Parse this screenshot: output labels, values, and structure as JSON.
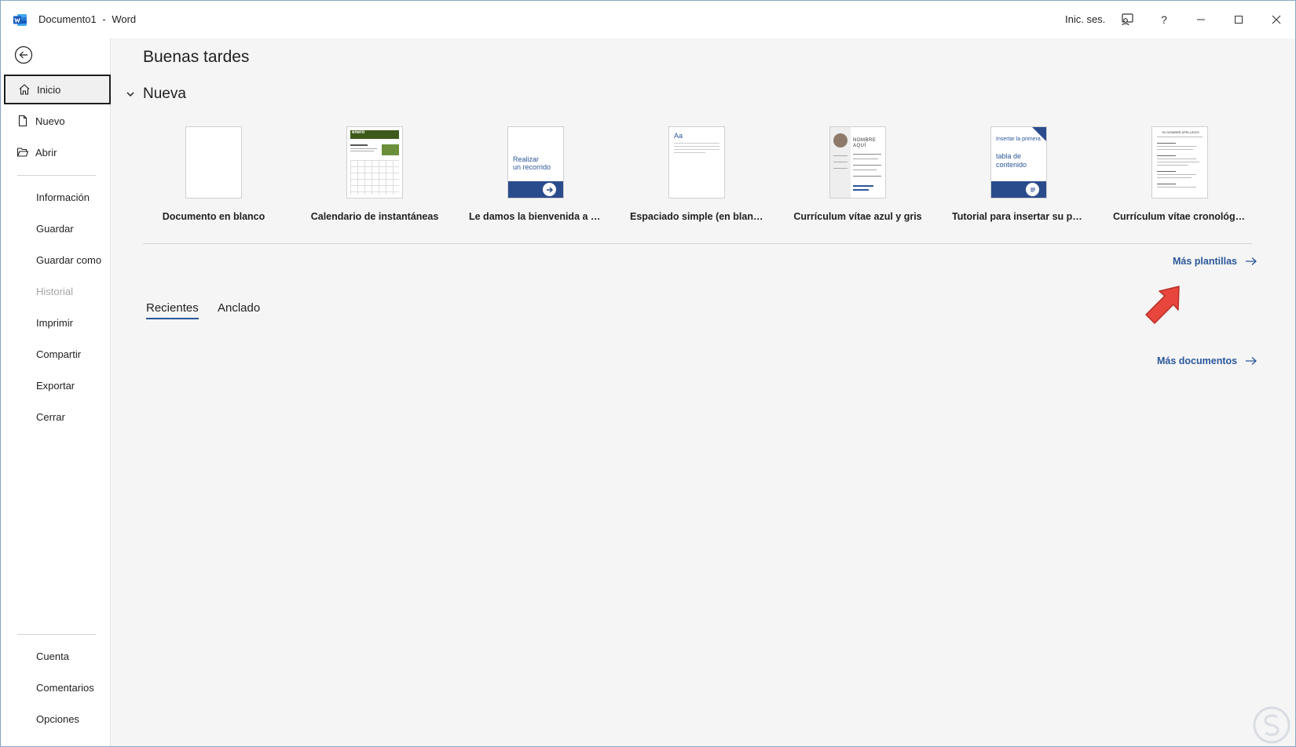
{
  "window": {
    "doc_title": "Documento1",
    "separator": "-",
    "app_name": "Word",
    "sign_in": "Inic. ses."
  },
  "sidebar": {
    "items": [
      {
        "label": "Inicio",
        "icon": "home-icon"
      },
      {
        "label": "Nuevo",
        "icon": "new-document-icon"
      },
      {
        "label": "Abrir",
        "icon": "open-folder-icon"
      }
    ],
    "secondary": [
      {
        "label": "Información"
      },
      {
        "label": "Guardar"
      },
      {
        "label": "Guardar como"
      },
      {
        "label": "Historial"
      },
      {
        "label": "Imprimir"
      },
      {
        "label": "Compartir"
      },
      {
        "label": "Exportar"
      },
      {
        "label": "Cerrar"
      }
    ],
    "footer": [
      {
        "label": "Cuenta"
      },
      {
        "label": "Comentarios"
      },
      {
        "label": "Opciones"
      }
    ]
  },
  "main": {
    "greeting": "Buenas tardes",
    "new_section_title": "Nueva",
    "templates": [
      {
        "label": "Documento en blanco"
      },
      {
        "label": "Calendario de instantáneas",
        "thumb_heading": "enero"
      },
      {
        "label": "Le damos la bienvenida a W...",
        "thumb_text_1": "Realizar",
        "thumb_text_2": "un recorrido"
      },
      {
        "label": "Espaciado simple (en blanco)",
        "thumb_text": "Aa"
      },
      {
        "label": "Currículum vítae azul y gris",
        "thumb_text_1": "NOMBRE",
        "thumb_text_2": "AQUÍ"
      },
      {
        "label": "Tutorial para insertar su prim...",
        "thumb_text_1": "Insertar la primera",
        "thumb_text_2": "tabla de",
        "thumb_text_3": "contenido"
      },
      {
        "label": "Currículum vítae cronológic...",
        "thumb_text": "SU NOMBRE APELLIDOS"
      }
    ],
    "more_templates": "Más plantillas",
    "tabs": [
      {
        "label": "Recientes"
      },
      {
        "label": "Anclado"
      }
    ],
    "more_documents": "Más documentos"
  },
  "colors": {
    "accent": "#2b579a",
    "pointer_arrow": "#e8453c"
  }
}
